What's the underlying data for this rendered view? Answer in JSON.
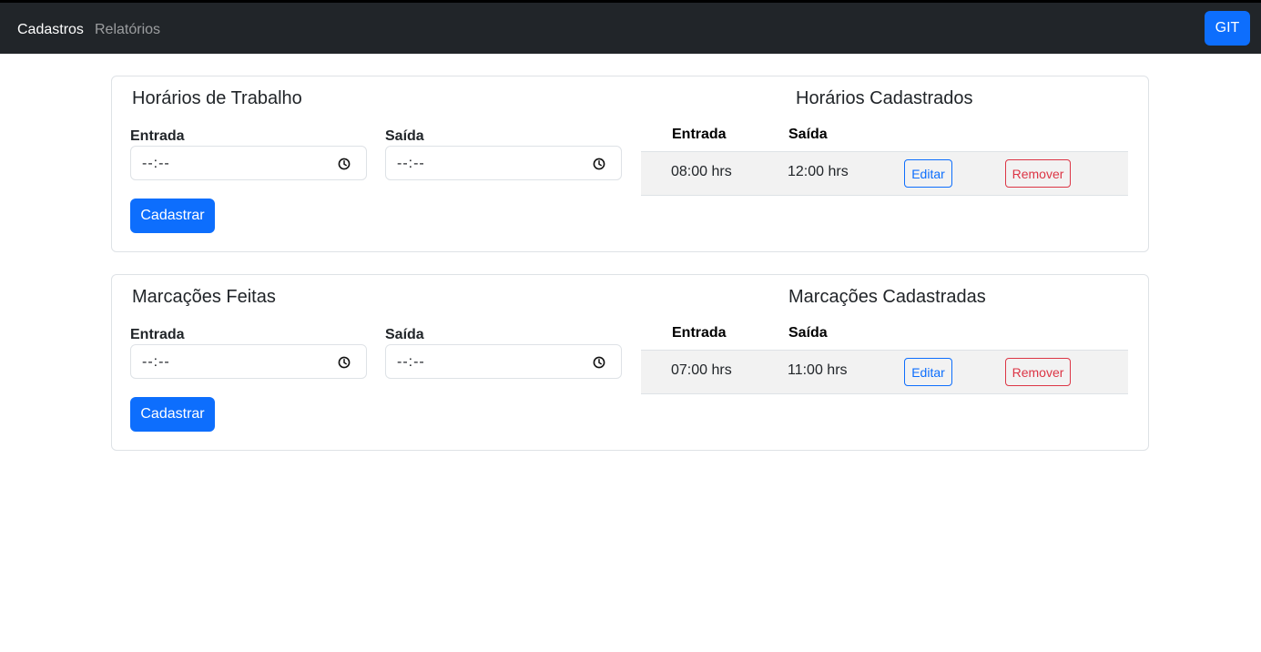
{
  "navbar": {
    "links": [
      {
        "label": "Cadastros",
        "active": true
      },
      {
        "label": "Relatórios",
        "active": false
      }
    ],
    "git_button": "GIT"
  },
  "cards": [
    {
      "form_title": "Horários de Trabalho",
      "entrada_label": "Entrada",
      "saida_label": "Saída",
      "entrada_value": "--:--",
      "saida_value": "--:--",
      "submit_label": "Cadastrar",
      "list_title": "Horários Cadastrados",
      "columns": [
        "Entrada",
        "Saída"
      ],
      "rows": [
        {
          "entrada": "08:00 hrs",
          "saida": "12:00 hrs",
          "edit_label": "Editar",
          "remove_label": "Remover"
        }
      ]
    },
    {
      "form_title": "Marcações Feitas",
      "entrada_label": "Entrada",
      "saida_label": "Saída",
      "entrada_value": "--:--",
      "saida_value": "--:--",
      "submit_label": "Cadastrar",
      "list_title": "Marcações Cadastradas",
      "columns": [
        "Entrada",
        "Saída"
      ],
      "rows": [
        {
          "entrada": "07:00 hrs",
          "saida": "11:00 hrs",
          "edit_label": "Editar",
          "remove_label": "Remover"
        }
      ]
    }
  ],
  "icons": {
    "time_input": "clock-icon"
  },
  "colors": {
    "navbar_bg": "#212529",
    "primary": "#0d6efd",
    "danger": "#dc3545",
    "row_bg": "#f2f2f2"
  }
}
